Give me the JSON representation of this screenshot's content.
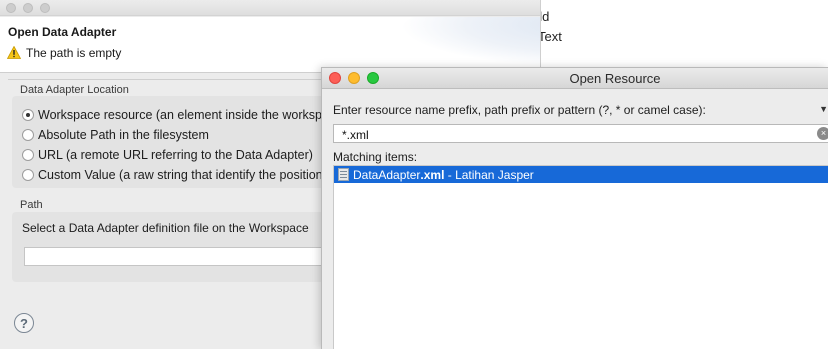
{
  "background": {
    "partial_text_1": "eld",
    "partial_text_2": "Text"
  },
  "adapter_dialog": {
    "title": "Open Data Adapter",
    "message": "The path is empty",
    "location_group": {
      "label": "Data Adapter Location",
      "options": [
        {
          "label": "Workspace resource (an element inside the workspace)",
          "checked": true
        },
        {
          "label": "Absolute Path in the filesystem",
          "checked": false
        },
        {
          "label": "URL (a remote URL referring to the Data Adapter)",
          "checked": false
        },
        {
          "label": "Custom Value (a raw string that identify the position)",
          "checked": false
        }
      ]
    },
    "path_group": {
      "label": "Path",
      "description": "Select a Data Adapter definition file on the Workspace",
      "value": ""
    },
    "help_icon": "help-icon"
  },
  "resource_dialog": {
    "title": "Open Resource",
    "prompt": "Enter resource name prefix, path prefix or pattern (?, * or camel case):",
    "search_value": "*.xml",
    "matching_label": "Matching items:",
    "results": [
      {
        "name_prefix": "DataAdapter",
        "name_match": ".xml",
        "suffix": " - Latihan Jasper",
        "selected": true
      }
    ],
    "colors": {
      "selection": "#1769d8",
      "close": "#fd5f57",
      "minimize": "#febc2e",
      "zoom": "#28c840"
    }
  }
}
